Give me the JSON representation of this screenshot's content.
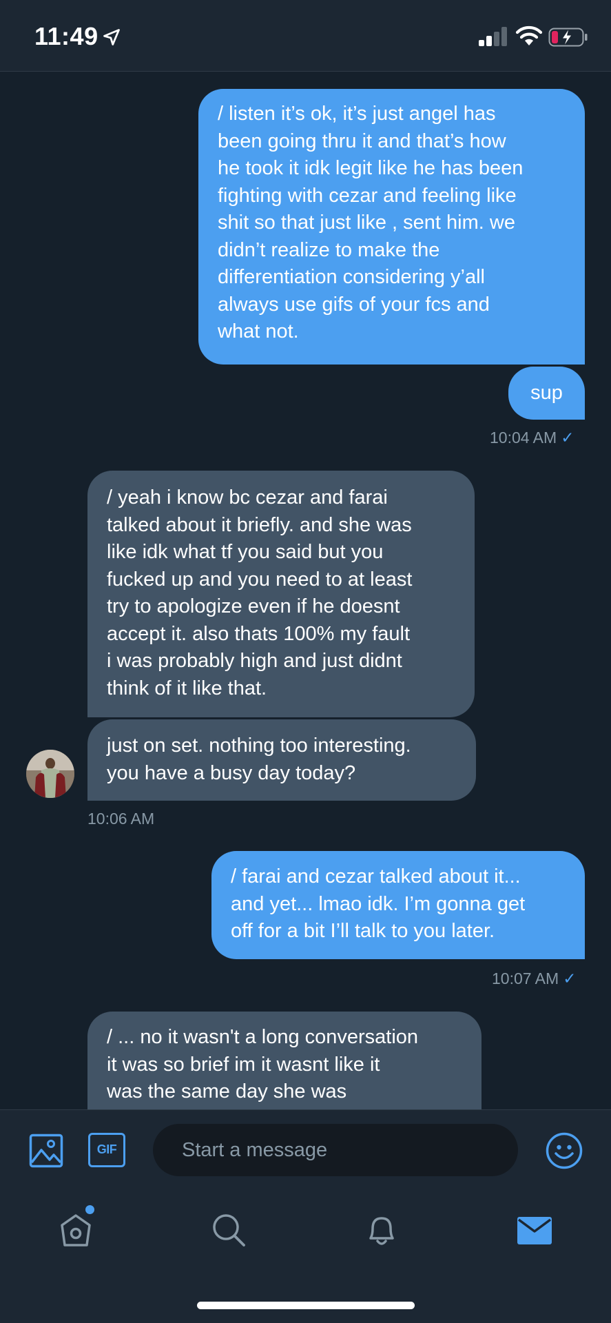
{
  "status_bar": {
    "time": "11:49",
    "icons": [
      "location-arrow-icon",
      "cellular-signal-icon",
      "wifi-icon",
      "battery-charging-icon"
    ]
  },
  "messages": [
    {
      "direction": "out",
      "text": "/ listen it’s ok, it’s just angel has\nbeen going thru it and that’s how\nhe took it idk legit like he has been\nfighting with cezar and feeling like\nshit so that just like , sent him. we\ndidn’t realize to make the\ndifferentiation considering y’all\nalways use gifs of your fcs and\nwhat not."
    },
    {
      "direction": "out",
      "text": "sup"
    },
    {
      "direction": "in",
      "text": "/ yeah i know bc cezar and farai\ntalked about it briefly. and she was\nlike idk what tf you said but you\nfucked up and you need to at least\ntry to apologize even if he doesnt\naccept it. also thats 100% my fault\ni was probably high and just didnt\nthink of it like that."
    },
    {
      "direction": "in",
      "text": "just on set. nothing too interesting.\nyou have a busy day today?"
    },
    {
      "direction": "out",
      "text": "/ farai and cezar talked about it...\nand yet... lmao idk. I’m gonna get\noff for a bit I’ll talk to you later."
    },
    {
      "direction": "in",
      "text": "/ ... no it wasn't a long conversation\nit was so brief im it wasnt like it\nwas the same day she was"
    }
  ],
  "timestamps": {
    "t1": "10:04 AM",
    "t2": "10:06 AM",
    "t3": "10:07 AM",
    "read_mark": "✓"
  },
  "composer": {
    "placeholder": "Start a message",
    "gif_label": "GIF",
    "icons": [
      "image-icon",
      "gif-icon",
      "emoji-icon"
    ]
  },
  "tab_bar": {
    "tabs": [
      "home",
      "search",
      "notifications",
      "messages"
    ],
    "active": "messages",
    "home_has_new": true
  },
  "colors": {
    "background": "#15202b",
    "bar": "#1c2733",
    "outgoing_bubble": "#4c9ff0",
    "incoming_bubble": "#425466",
    "muted_text": "#8899a6",
    "accent": "#4c9ff0"
  }
}
